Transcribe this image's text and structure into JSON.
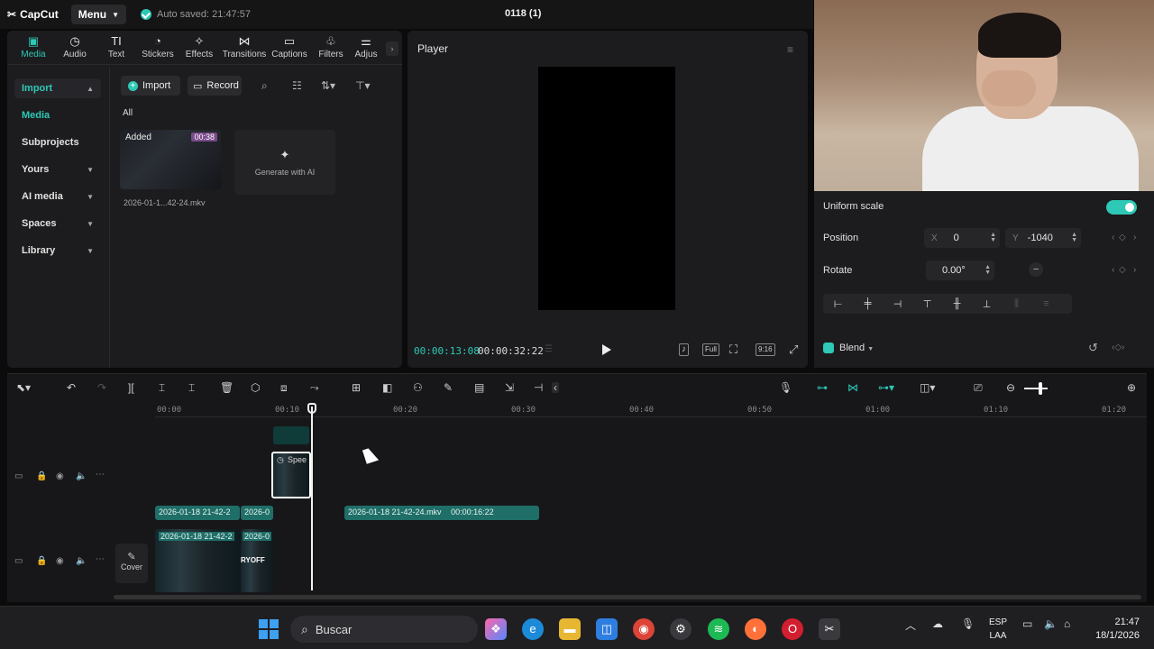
{
  "app": {
    "brand": "CapCut",
    "menu_label": "Menu",
    "autosave": "Auto saved: 21:47:57",
    "project_title": "0118 (1)"
  },
  "tabs": [
    {
      "label": "Media",
      "icon": "media-icon"
    },
    {
      "label": "Audio",
      "icon": "audio-icon"
    },
    {
      "label": "Text",
      "icon": "text-icon"
    },
    {
      "label": "Stickers",
      "icon": "stickers-icon"
    },
    {
      "label": "Effects",
      "icon": "effects-icon"
    },
    {
      "label": "Transitions",
      "icon": "transitions-icon"
    },
    {
      "label": "Captions",
      "icon": "captions-icon"
    },
    {
      "label": "Filters",
      "icon": "filters-icon"
    },
    {
      "label": "Adjus",
      "icon": "adjust-icon"
    }
  ],
  "sidenav": {
    "import": "Import",
    "media": "Media",
    "subprojects": "Subprojects",
    "yours": "Yours",
    "ai_media": "AI media",
    "spaces": "Spaces",
    "library": "Library"
  },
  "media": {
    "import_btn": "Import",
    "record_btn": "Record",
    "filter_all": "All",
    "item_badge": "Added",
    "item_duration": "00:38",
    "item_name": "2026-01-1...42-24.mkv",
    "generate_label": "Generate with AI"
  },
  "player": {
    "title": "Player",
    "current_time": "00:00:13:08",
    "total_time": "00:00:32:22",
    "full_label": "Full",
    "ratio_label": "9:16"
  },
  "props": {
    "uniform_scale": "Uniform scale",
    "position_label": "Position",
    "x_axis": "X",
    "x_value": "0",
    "y_axis": "Y",
    "y_value": "-1040",
    "rotate_label": "Rotate",
    "rotate_value": "0.00°",
    "blend_label": "Blend"
  },
  "timeline": {
    "ruler": [
      "00:00",
      "00:10",
      "00:20",
      "00:30",
      "00:40",
      "00:50",
      "01:00",
      "01:10",
      "01:20"
    ],
    "speed_clip": "Spee",
    "audio_clip_a": "2026-01-18 21-42-2",
    "audio_clip_b": "2026-0",
    "audio_clip_c": "2026-01-18 21-42-24.mkv",
    "audio_clip_c_dur": "00:00:16:22",
    "video_clip_a": "2026-01-18 21-42-2",
    "video_clip_b": "2026-0",
    "video_overlay_text": "RYOFF",
    "cover_label": "Cover"
  },
  "taskbar": {
    "search_placeholder": "Buscar",
    "lang_top": "ESP",
    "lang_bottom": "LAA",
    "time": "21:47",
    "date": "18/1/2026"
  },
  "colors": {
    "accent": "#2ec8b6",
    "panel": "#1c1c1e",
    "background": "#0b0b0c"
  }
}
